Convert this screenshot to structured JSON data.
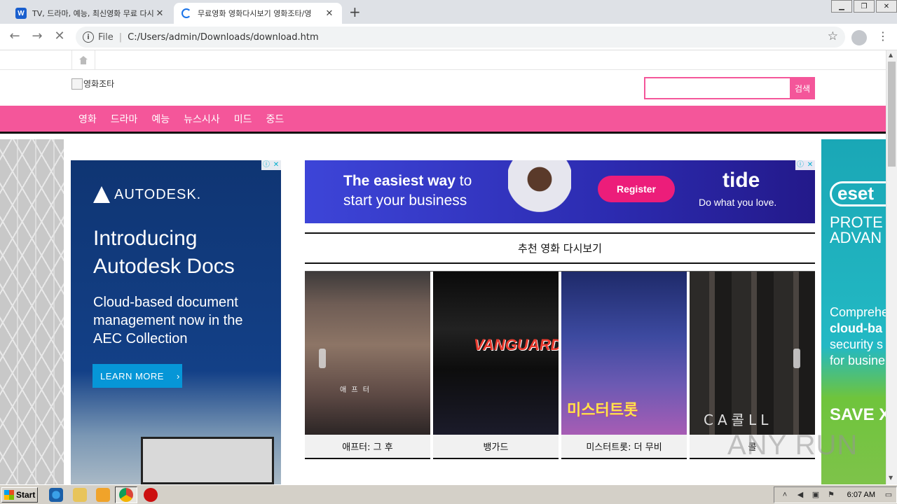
{
  "browser": {
    "tabs": [
      {
        "title": "TV, 드라마, 예능, 최신영화 무료 다시",
        "favicon": "w-icon",
        "active": false
      },
      {
        "title": "무료영화 영화다시보기 영화조타/영",
        "favicon": "loading-spinner-icon",
        "active": true
      }
    ],
    "new_tab_label": "+",
    "address": {
      "scheme_label": "File",
      "url": "C:/Users/admin/Downloads/download.htm"
    },
    "window_controls": [
      "minimize",
      "restore",
      "close"
    ]
  },
  "site": {
    "logo_alt": "영화조타",
    "search": {
      "value": "",
      "button_label": "검색"
    },
    "nav": [
      "영화",
      "드라마",
      "예능",
      "뉴스시사",
      "미드",
      "중드"
    ],
    "accent_color": "#f4569a",
    "section_title": "추천 영화 다시보기",
    "movies": [
      {
        "title": "애프터: 그 후",
        "poster_text": "애 프 터"
      },
      {
        "title": "뱅가드",
        "poster_text": "VANGUARD"
      },
      {
        "title": "미스터트롯: 더 무비",
        "poster_text": "미스터트롯"
      },
      {
        "title": "콜",
        "poster_text": "CA콜LL"
      }
    ]
  },
  "ads": {
    "left": {
      "brand": "AUTODESK.",
      "headline": "Introducing Autodesk Docs",
      "body": "Cloud-based document management now in the AEC Collection",
      "cta": "LEARN MORE",
      "cta_arrow": "›"
    },
    "banner": {
      "tagline_bold": "The easiest way",
      "tagline_rest": " to",
      "tagline_line2": "start your business",
      "button": "Register",
      "brand": "tide",
      "slogan": "Do what you love."
    },
    "right": {
      "brand": "eset",
      "line1": "PROTE",
      "line2": "ADVAN",
      "line3": "Comprehe",
      "line4": "cloud-ba",
      "line5": "security s",
      "line6": "for busine",
      "cta": "SAVE X"
    },
    "adchoices": [
      "ⓘ",
      "✕"
    ]
  },
  "watermark": "ANY RUN",
  "taskbar": {
    "start_label": "Start",
    "clock": "6:07 AM"
  }
}
